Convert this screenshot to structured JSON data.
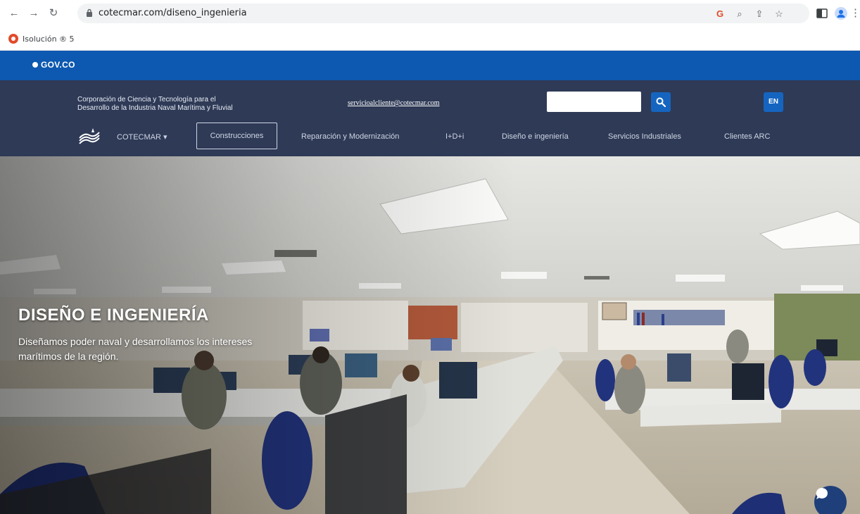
{
  "browser": {
    "url": "cotecmar.com/diseno_ingenieria",
    "bookmark_label": "Isolución ® 5"
  },
  "gov": {
    "logo_text": "GOV.CO"
  },
  "header": {
    "tagline_line1": "Corporación de Ciencia y Tecnología para el",
    "tagline_line2": "Desarrollo de la Industria Naval Marítima y Fluvial",
    "email": "servicioalcliente@cotecmar.com",
    "search_placeholder": "",
    "lang_button": "EN"
  },
  "nav": {
    "items": [
      {
        "label": "COTECMAR ▾"
      },
      {
        "label": "Construcciones"
      },
      {
        "label": "Reparación y Modernización"
      },
      {
        "label": "I+D+i"
      },
      {
        "label": "Diseño e ingeniería"
      },
      {
        "label": "Servicios Industriales"
      },
      {
        "label": "Clientes ARC"
      }
    ]
  },
  "hero": {
    "title": "DISEÑO E INGENIERÍA",
    "subtitle": "Diseñamos poder naval y desarrollamos los intereses marítimos de la región."
  },
  "colors": {
    "gov_blue": "#0d58b0",
    "header_navy": "#2e3a56",
    "button_blue": "#1565c0",
    "chat_navy": "#1f3f7a"
  },
  "icons": {
    "back": "arrow-left-icon",
    "forward": "arrow-right-icon",
    "reload": "reload-icon",
    "lock": "lock-icon",
    "search": "magnifier-icon",
    "chat": "chat-bubble-icon"
  }
}
